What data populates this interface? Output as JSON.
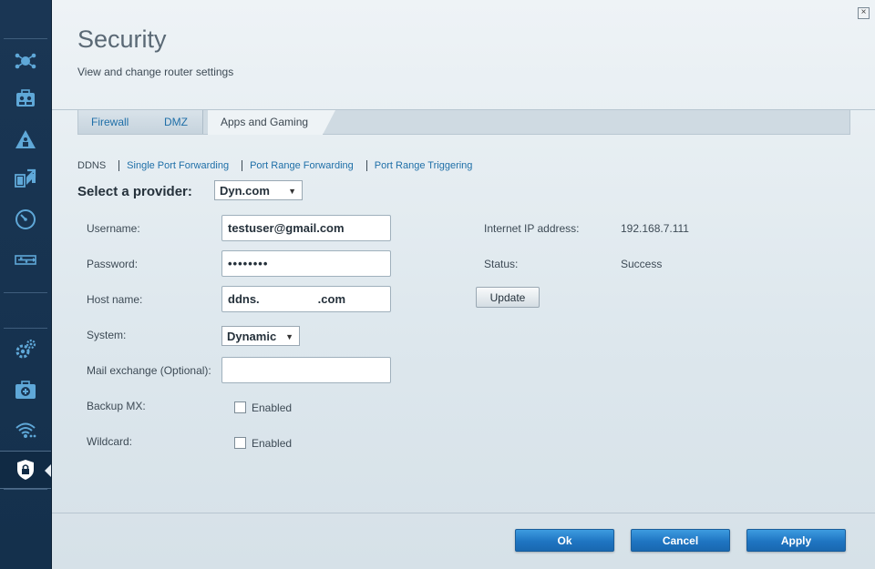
{
  "page": {
    "title": "Security",
    "subtitle": "View and change router settings"
  },
  "tabs": [
    {
      "label": "Firewall"
    },
    {
      "label": "DMZ"
    },
    {
      "label": "Apps and Gaming"
    }
  ],
  "subnav": {
    "current": "DDNS",
    "links": [
      "Single Port Forwarding",
      "Port Range Forwarding",
      "Port Range Triggering"
    ]
  },
  "provider": {
    "label": "Select a provider:",
    "value": "Dyn.com"
  },
  "form": {
    "username": {
      "label": "Username:",
      "value": "testuser@gmail.com"
    },
    "password": {
      "label": "Password:",
      "value": "••••••••"
    },
    "hostname": {
      "label": "Host name:",
      "prefix": "ddns.",
      "suffix": ".com"
    },
    "system": {
      "label": "System:",
      "value": "Dynamic"
    },
    "mail_exchange": {
      "label": "Mail exchange (Optional):",
      "value": ""
    },
    "backup_mx": {
      "label": "Backup MX:",
      "checkbox_label": "Enabled"
    },
    "wildcard": {
      "label": "Wildcard:",
      "checkbox_label": "Enabled"
    }
  },
  "status_panel": {
    "ip_label": "Internet IP address:",
    "ip_value": "192.168.7.111",
    "status_label": "Status:",
    "status_value": "Success",
    "update_label": "Update"
  },
  "footer": {
    "ok": "Ok",
    "cancel": "Cancel",
    "apply": "Apply"
  },
  "sidebar": {
    "icons": [
      "network-map-icon",
      "guest-access-icon",
      "parental-controls-icon",
      "media-prioritization-icon",
      "speed-test-icon",
      "usb-storage-icon",
      "connectivity-icon",
      "troubleshooting-icon",
      "wireless-icon",
      "security-icon"
    ]
  },
  "colors": {
    "accent_blue": "#1f75c2",
    "link_blue": "#1f6fa8",
    "sidebar_bg": "#1a3654"
  }
}
